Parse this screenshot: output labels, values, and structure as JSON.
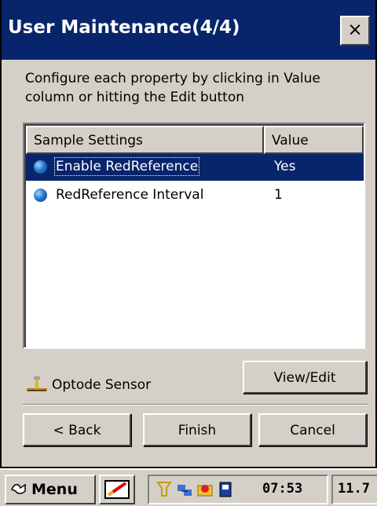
{
  "dialog": {
    "title": "User Maintenance(4/4)",
    "close_label": "×",
    "instruction": "Configure each property by clicking in Value column or hitting the Edit button"
  },
  "list": {
    "columns": [
      "Sample Settings",
      "Value"
    ],
    "rows": [
      {
        "name": "Enable RedReference",
        "value": "Yes",
        "selected": true
      },
      {
        "name": "RedReference Interval",
        "value": "1",
        "selected": false
      }
    ]
  },
  "sensor": {
    "label": "Optode Sensor",
    "icon": "sensor-icon"
  },
  "buttons": {
    "view_edit": "View/Edit",
    "back": "< Back",
    "finish": "Finish",
    "cancel": "Cancel"
  },
  "taskbar": {
    "start_label": "Menu",
    "clock": "07:53",
    "extra": "11.7"
  },
  "colors": {
    "title_bar": "#08246b",
    "selection": "#08246b",
    "face": "#d4d0c8"
  }
}
